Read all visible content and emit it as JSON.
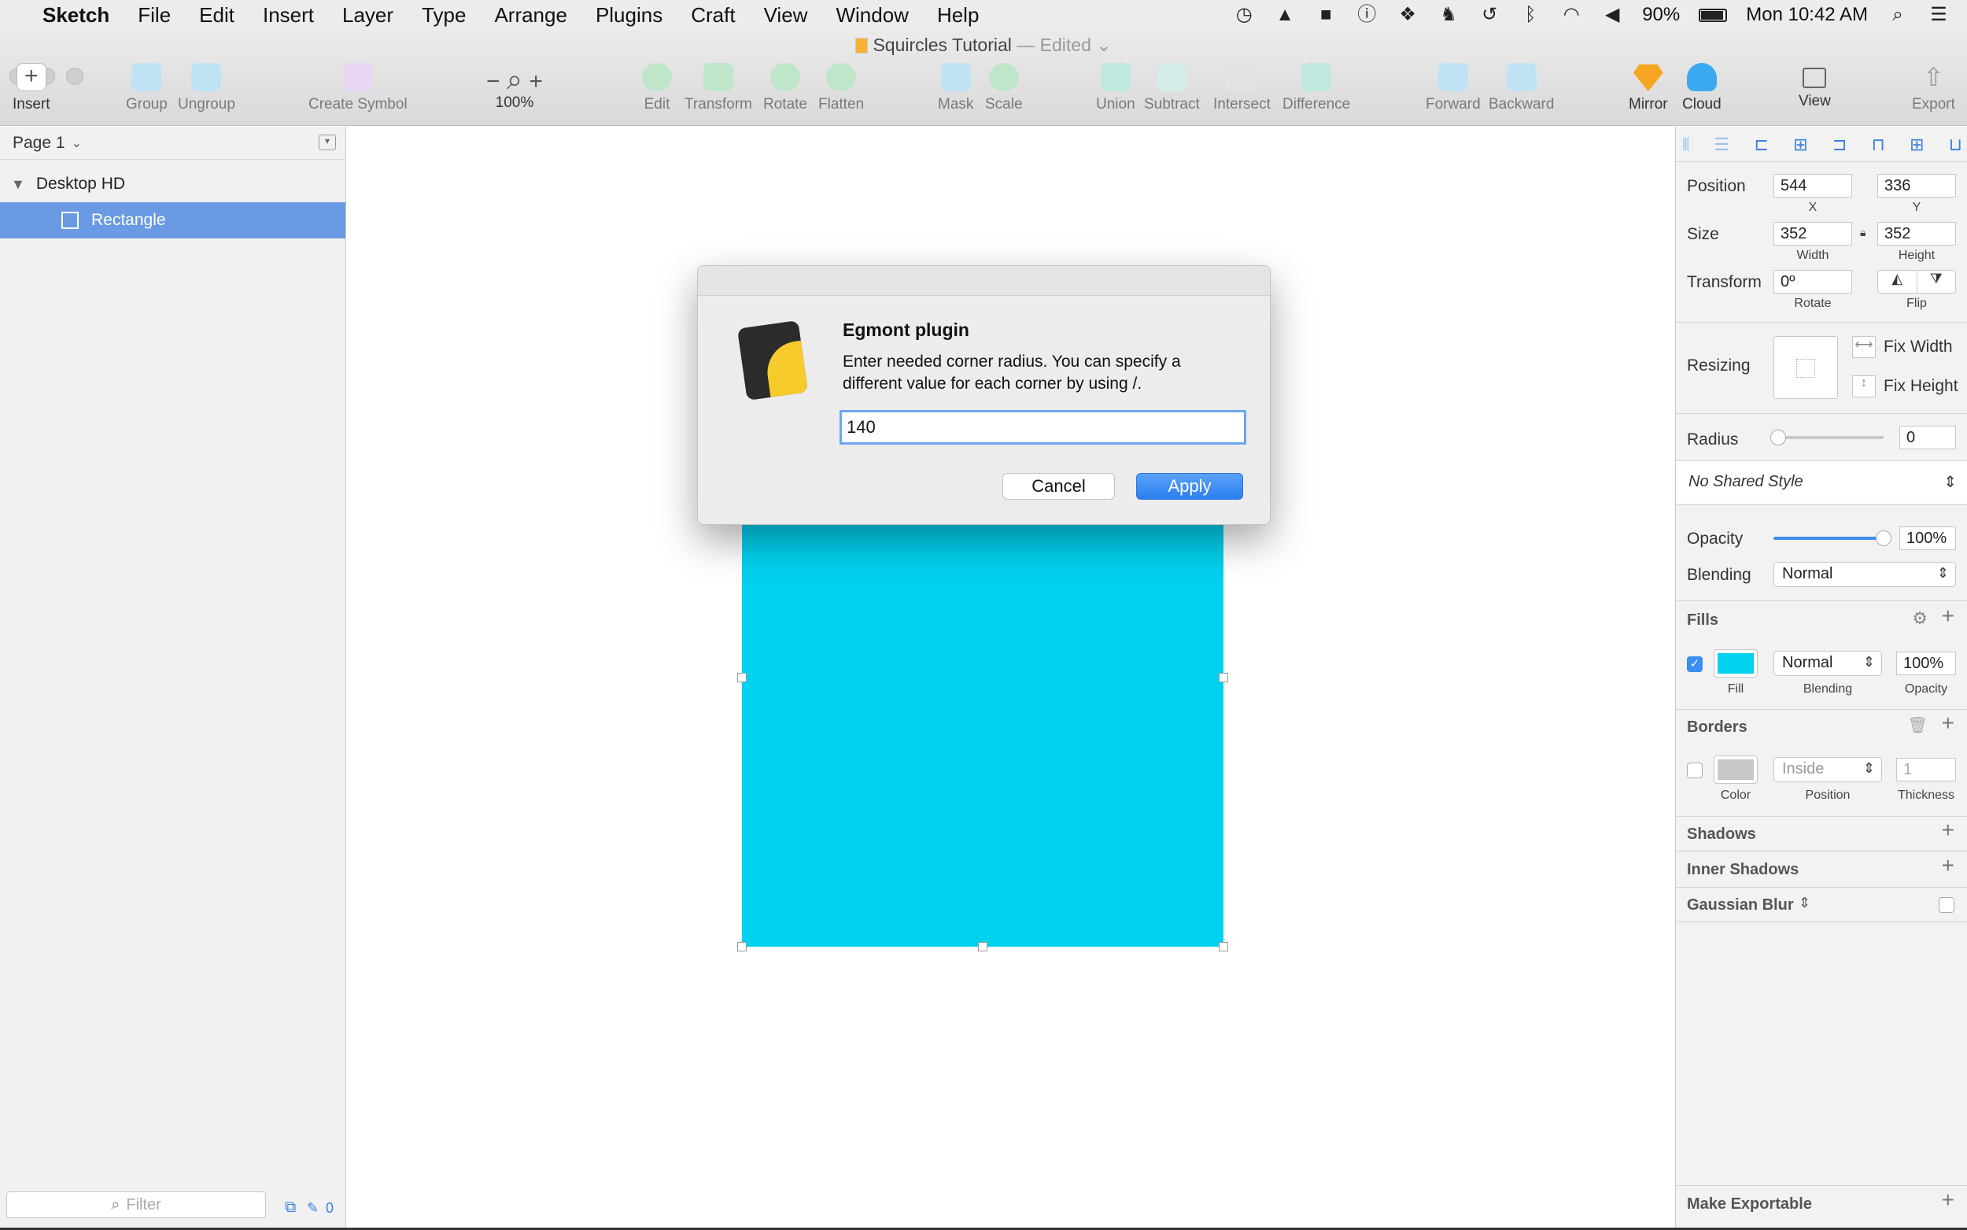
{
  "menubar": {
    "apple": "",
    "app": "Sketch",
    "menus": [
      "File",
      "Edit",
      "Insert",
      "Layer",
      "Type",
      "Arrange",
      "Plugins",
      "Craft",
      "View",
      "Window",
      "Help"
    ],
    "battery": "90%",
    "clock": "Mon 10:42 AM"
  },
  "window": {
    "title": "Squircles Tutorial",
    "title_suffix": "— Edited ⌄"
  },
  "toolbar": {
    "insert": "Insert",
    "group": "Group",
    "ungroup": "Ungroup",
    "create_symbol": "Create Symbol",
    "zoom": "100%",
    "edit": "Edit",
    "transform": "Transform",
    "rotate": "Rotate",
    "flatten": "Flatten",
    "mask": "Mask",
    "scale": "Scale",
    "union": "Union",
    "subtract": "Subtract",
    "intersect": "Intersect",
    "difference": "Difference",
    "forward": "Forward",
    "backward": "Backward",
    "mirror": "Mirror",
    "cloud": "Cloud",
    "view": "View",
    "export": "Export"
  },
  "layers": {
    "page": "Page 1",
    "artboard": "Desktop HD",
    "layer": "Rectangle",
    "filter_placeholder": "Filter",
    "count": "0"
  },
  "dialog": {
    "title": "Egmont plugin",
    "message": "Enter needed corner radius. You can specify a different value for each corner by using /.",
    "value": "140",
    "cancel": "Cancel",
    "apply": "Apply"
  },
  "inspector": {
    "position_label": "Position",
    "x": "544",
    "y": "336",
    "x_label": "X",
    "y_label": "Y",
    "size_label": "Size",
    "width": "352",
    "height": "352",
    "width_label": "Width",
    "height_label": "Height",
    "transform_label": "Transform",
    "rotate": "0º",
    "rotate_label": "Rotate",
    "flip_label": "Flip",
    "resizing_label": "Resizing",
    "fix_width": "Fix Width",
    "fix_height": "Fix Height",
    "radius_label": "Radius",
    "radius": "0",
    "shared_style": "No Shared Style",
    "opacity_label": "Opacity",
    "opacity": "100%",
    "opacity_level": 1.0,
    "blending_label": "Blending",
    "blending": "Normal",
    "fills_label": "Fills",
    "fill_color": "#00d1ee",
    "fill_blending": "Normal",
    "fill_opacity": "100%",
    "fill_label": "Fill",
    "fill_blending_label": "Blending",
    "fill_opacity_label": "Opacity",
    "borders_label": "Borders",
    "border_position": "Inside",
    "border_thickness": "1",
    "color_label": "Color",
    "position_col_label": "Position",
    "thickness_label": "Thickness",
    "shadows": "Shadows",
    "inner_shadows": "Inner Shadows",
    "gaussian_blur": "Gaussian Blur",
    "make_exportable": "Make Exportable"
  }
}
